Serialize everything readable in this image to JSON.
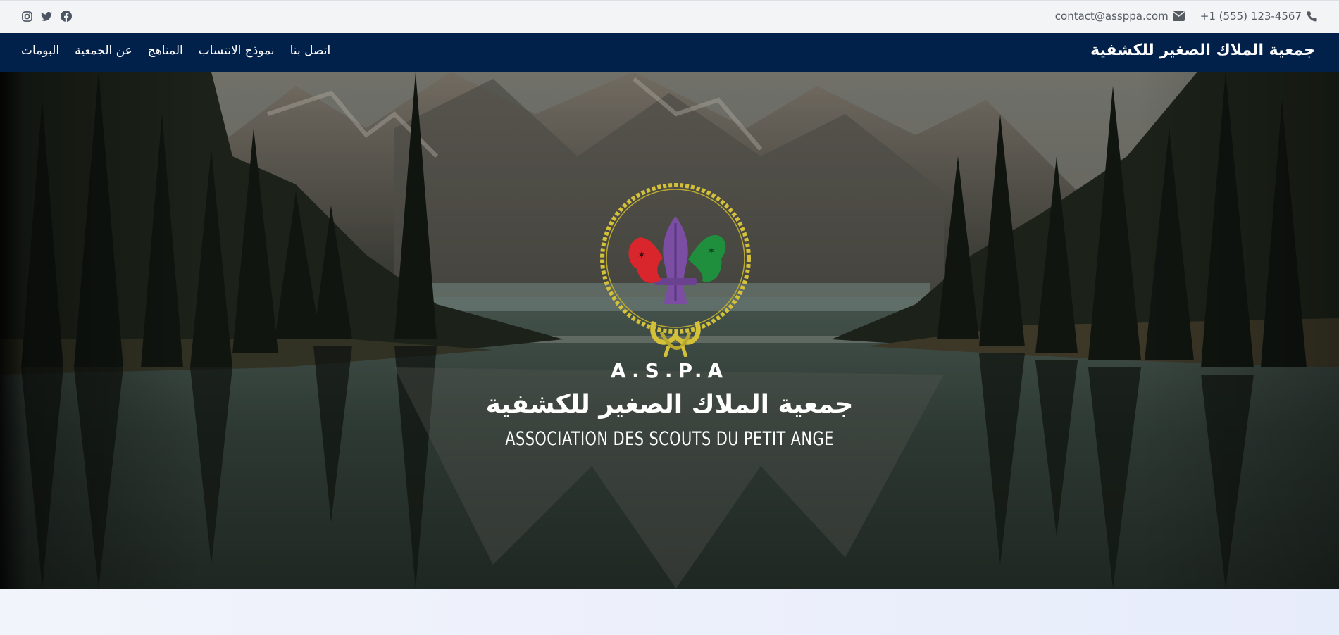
{
  "topbar": {
    "social_icons": [
      "instagram-icon",
      "twitter-icon",
      "facebook-icon"
    ],
    "email": "contact@assppa.com",
    "phone": "+1 (555) 123-4567",
    "email_icon": "envelope-icon",
    "phone_icon": "phone-icon"
  },
  "navbar": {
    "brand": "جمعية الملاك الصغير للكشفية",
    "links": [
      "البومات",
      "عن الجمعية",
      "المناهج",
      "نموذج الانتساب",
      "اتصل بنا"
    ],
    "background": "#01204a"
  },
  "hero": {
    "acronym": "A.S.P.A",
    "title_ar": "جمعية الملاك الصغير للكشفية",
    "title_fr": "ASSOCIATION DES SCOUTS DU PETIT ANGE",
    "logo_colors": {
      "rope": "#d4c13a",
      "left": "#d8262c",
      "center": "#7b4ea3",
      "right": "#1f8f3e"
    }
  }
}
